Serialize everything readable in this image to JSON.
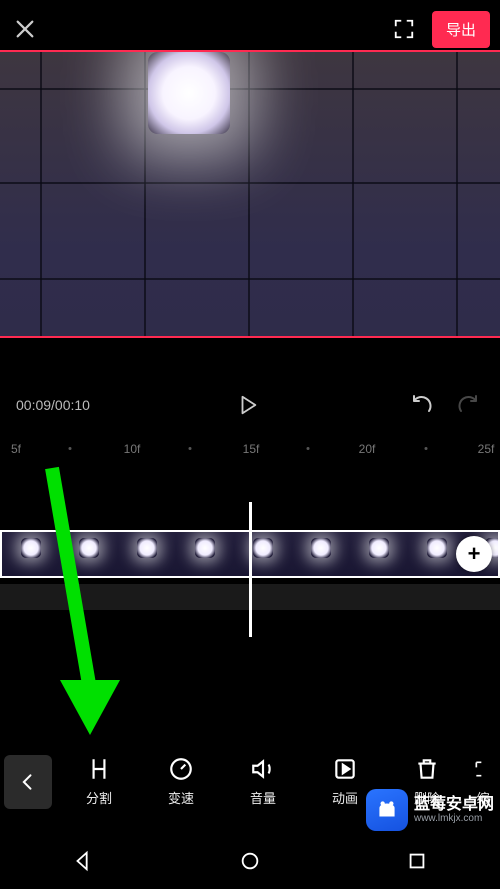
{
  "header": {
    "export_label": "导出"
  },
  "transport": {
    "time_display": "00:09/00:10"
  },
  "ruler": {
    "marks": [
      "5f",
      "10f",
      "15f",
      "20f",
      "25f"
    ]
  },
  "tools": {
    "back_icon": "chevron-left",
    "items": [
      {
        "id": "split",
        "label": "分割",
        "icon": "split-icon"
      },
      {
        "id": "speed",
        "label": "变速",
        "icon": "speed-icon"
      },
      {
        "id": "volume",
        "label": "音量",
        "icon": "volume-icon"
      },
      {
        "id": "anim",
        "label": "动画",
        "icon": "animation-icon"
      },
      {
        "id": "delete",
        "label": "删除",
        "icon": "delete-icon"
      },
      {
        "id": "scale",
        "label": "缩",
        "icon": "scale-icon"
      }
    ]
  },
  "add_clip": {
    "symbol": "+"
  },
  "watermark": {
    "title": "蓝莓安卓网",
    "url": "www.lmkjx.com"
  },
  "colors": {
    "accent": "#ff2a51",
    "arrow": "#00e000"
  }
}
